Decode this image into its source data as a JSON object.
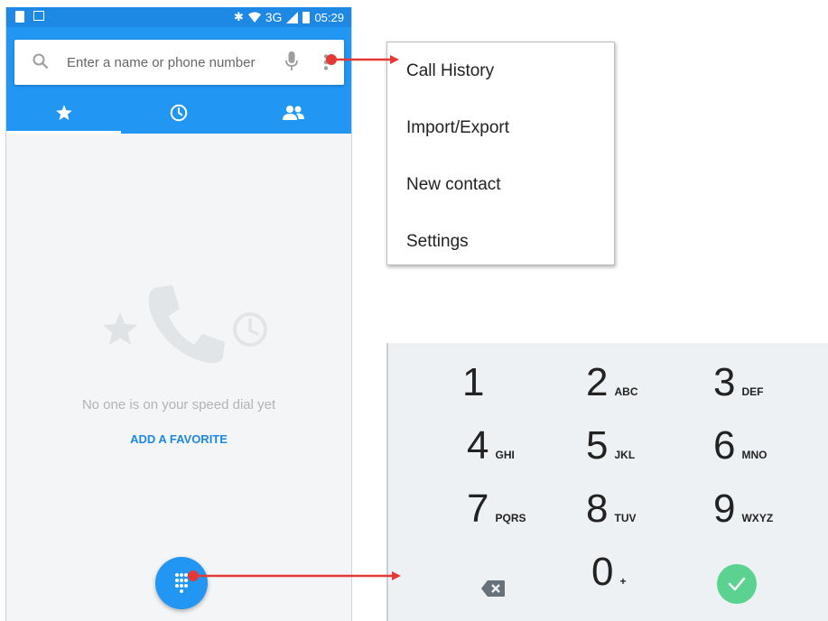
{
  "status_bar": {
    "network": "3G",
    "time": "05:29"
  },
  "search": {
    "placeholder": "Enter a name or phone number"
  },
  "tabs": [
    {
      "icon": "star-icon"
    },
    {
      "icon": "clock-icon"
    },
    {
      "icon": "people-icon"
    }
  ],
  "empty_state": {
    "message": "No one is on your speed dial yet",
    "action": "ADD A FAVORITE"
  },
  "menu": {
    "items": [
      {
        "label": "Call History"
      },
      {
        "label": "Import/Export"
      },
      {
        "label": "New contact"
      },
      {
        "label": "Settings"
      }
    ]
  },
  "dialpad": {
    "keys": [
      {
        "digit": "1",
        "letters": ""
      },
      {
        "digit": "2",
        "letters": "ABC"
      },
      {
        "digit": "3",
        "letters": "DEF"
      },
      {
        "digit": "4",
        "letters": "GHI"
      },
      {
        "digit": "5",
        "letters": "JKL"
      },
      {
        "digit": "6",
        "letters": "MNO"
      },
      {
        "digit": "7",
        "letters": "PQRS"
      },
      {
        "digit": "8",
        "letters": "TUV"
      },
      {
        "digit": "9",
        "letters": "WXYZ"
      },
      {
        "digit": "0",
        "letters": "+"
      }
    ]
  },
  "colors": {
    "primary": "#2196f3",
    "status_bar": "#1e88e5",
    "accent_link": "#1e88e5",
    "call_button": "#5bd28f",
    "annotation_arrow": "#e53935"
  }
}
